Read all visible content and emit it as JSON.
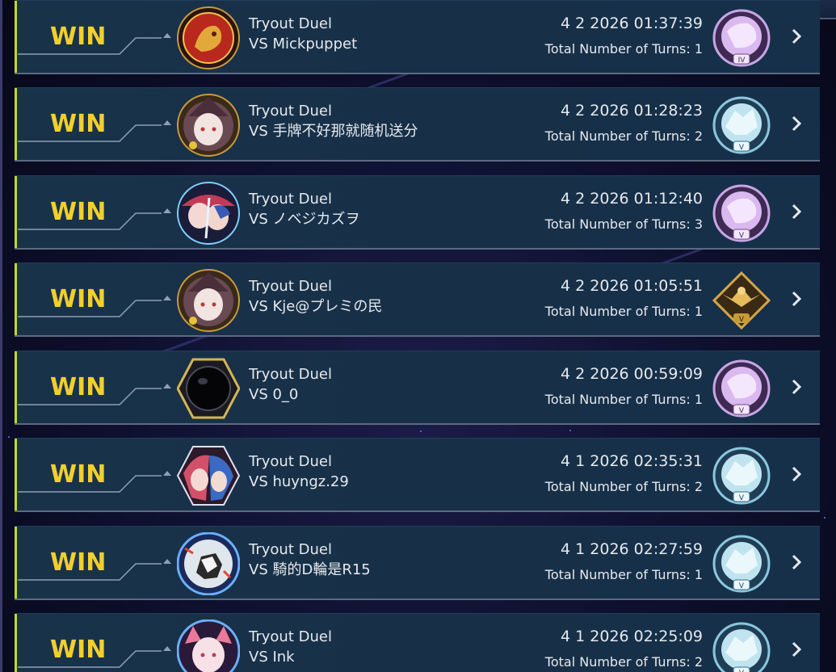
{
  "colors": {
    "result_win": "#f2cf2b",
    "row_bg": "#173048",
    "accent": "#c5d52a",
    "text": "#e6e9ee"
  },
  "duels": [
    {
      "result": "WIN",
      "mode": "Tryout Duel",
      "opponent": "VS  Mickpuppet",
      "datetime": "4 2 2026 01:37:39",
      "turns": "Total Number of Turns: 1",
      "avatar": "golden-dragon-emblem",
      "rank": "pink-bear-rank-icon",
      "rank_tier": "IV"
    },
    {
      "result": "WIN",
      "mode": "Tryout Duel",
      "opponent": "VS  手牌不好那就随机送分",
      "datetime": "4 2 2026 01:28:23",
      "turns": "Total Number of Turns: 2",
      "avatar": "witch-girl-portrait",
      "rank": "blue-wolf-rank-icon",
      "rank_tier": "V"
    },
    {
      "result": "WIN",
      "mode": "Tryout Duel",
      "opponent": "VS  ノベジカズヲ",
      "datetime": "4 2 2026 01:12:40",
      "turns": "Total Number of Turns: 3",
      "avatar": "twin-girls-portrait",
      "rank": "pink-bear-rank-icon",
      "rank_tier": "V"
    },
    {
      "result": "WIN",
      "mode": "Tryout Duel",
      "opponent": "VS  Kje@プレミの民",
      "datetime": "4 2 2026 01:05:51",
      "turns": "Total Number of Turns: 1",
      "avatar": "witch-girl-portrait",
      "rank": "gold-eagle-rank-icon",
      "rank_tier": "V"
    },
    {
      "result": "WIN",
      "mode": "Tryout Duel",
      "opponent": "VS  0_0",
      "datetime": "4 2 2026 00:59:09",
      "turns": "Total Number of Turns: 1",
      "avatar": "black-orb-hexagon",
      "rank": "pink-bear-rank-icon",
      "rank_tier": "V"
    },
    {
      "result": "WIN",
      "mode": "Tryout Duel",
      "opponent": "VS  huyngz.29",
      "datetime": "4 1 2026 02:35:31",
      "turns": "Total Number of Turns: 2",
      "avatar": "twin-girls-hexagon",
      "rank": "blue-wolf-rank-icon",
      "rank_tier": "V"
    },
    {
      "result": "WIN",
      "mode": "Tryout Duel",
      "opponent": "VS  騎的D輪是R15",
      "datetime": "4 1 2026 02:27:59",
      "turns": "Total Number of Turns: 1",
      "avatar": "cow-monster-portrait",
      "rank": "blue-wolf-rank-icon",
      "rank_tier": "V"
    },
    {
      "result": "WIN",
      "mode": "Tryout Duel",
      "opponent": "VS  Ink",
      "datetime": "4 1 2026 02:25:09",
      "turns": "Total Number of Turns: 2",
      "avatar": "fox-girl-portrait",
      "rank": "blue-wolf-rank-icon",
      "rank_tier": "V"
    }
  ]
}
